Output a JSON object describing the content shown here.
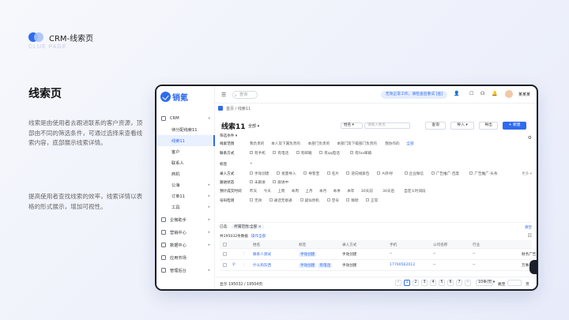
{
  "slide": {
    "title": "CRM-线索页",
    "subtitle": "CLUE PAGE",
    "section_title": "线索页",
    "para1": "线索是由使用者去跟进联系的客户资源，顶部由不同的筛选条件，可通过选择来查看线索内容，底部展示线索详情。",
    "para2": "提高使用者查找线索的效率，线索详情以表格的形式展示，增加可视性。"
  },
  "app": {
    "brand": "销氪",
    "topbar": {
      "search_placeholder": "查询",
      "notice": "无效正常工作，请检查后重试 [查]",
      "user": "某某某"
    },
    "sidebar": [
      {
        "label": "CRM",
        "type": "group",
        "chev": "▾"
      },
      {
        "label": "待分配线索11",
        "type": "sub"
      },
      {
        "label": "线索11",
        "type": "sub",
        "active": true
      },
      {
        "label": "客户",
        "type": "sub"
      },
      {
        "label": "联系人",
        "type": "sub"
      },
      {
        "label": "商机",
        "type": "sub"
      },
      {
        "label": "公海",
        "type": "sub",
        "chev": "▸"
      },
      {
        "label": "订单11",
        "type": "sub",
        "chev": "▸"
      },
      {
        "label": "工具",
        "type": "sub",
        "chev": "▸"
      },
      {
        "label": "企微助手",
        "type": "group",
        "chev": "▸"
      },
      {
        "label": "营销中心",
        "type": "group",
        "chev": "▸"
      },
      {
        "label": "数据中心",
        "type": "group",
        "chev": "▸"
      },
      {
        "label": "应用市场",
        "type": "group"
      },
      {
        "label": "管理后台",
        "type": "group",
        "chev": "▸"
      }
    ],
    "breadcrumb": "首页  /  线索11",
    "page_title": "线索11",
    "scope": "全部 ▾",
    "field_select": "姓名 ▾",
    "field_input_placeholder": "请输入姓名",
    "actions": {
      "query": "查询",
      "import": "导入 ▾",
      "export": "导出",
      "new": "+ 新建"
    },
    "filters": {
      "tag": "筛选条件 ▾",
      "rows": [
        {
          "label": "线索范围",
          "opts": [
            "我负责的",
            "本人及下属负责的",
            "本部门负责的",
            "本部门及下级部门负责的",
            "我协作的",
            "全部"
          ]
        },
        {
          "label": "联系方式",
          "opts": [
            "有手机",
            "有电话",
            "有邮箱",
            "有qq电话",
            "有fax邮箱"
          ]
        },
        {
          "label": "标签",
          "opts": [
            "+"
          ]
        },
        {
          "label": "录入方式",
          "opts": [
            "手动创建",
            "批量导入",
            "导客宝",
            "名片",
            "逆向线索包",
            "AI外呼",
            "企业微信",
            "广告推广-百度",
            "广告推广-头条"
          ]
        },
        {
          "label": "跟进状态",
          "opts": [
            "未跟进",
            "跟进中"
          ]
        },
        {
          "label": "预计成交时间",
          "opts": [
            "昨天",
            "今天",
            "上周",
            "本周",
            "上月",
            "本月",
            "本季",
            "本年",
            "30天前",
            "30天后",
            "自定义时间段"
          ]
        },
        {
          "label": "号码检测",
          "opts": [
            "无效",
            "通话无接通",
            "疑似停机",
            "空号",
            "静默",
            "正常"
          ]
        }
      ],
      "more": "更多 ▾"
    },
    "chips": {
      "label": "已选:",
      "items": [
        "所属范围:全部 ×"
      ],
      "clear": "清空"
    },
    "selection": {
      "text": "共195032条数据",
      "link": "操作全部"
    },
    "table": {
      "headers": [
        "",
        "",
        "",
        "姓名",
        "标签",
        "录入方式",
        "手机",
        "公司名称",
        "行业",
        ""
      ],
      "rows": [
        {
          "name": "联系人测试",
          "tags": [
            "手动创建"
          ],
          "entry": "手动创建",
          "phone": "--",
          "company": "--",
          "industry": "--",
          "extra": "财务广告"
        },
        {
          "name": "什么狗东西",
          "tags": [
            "手动创建",
            "有电话"
          ],
          "entry": "手动创建",
          "phone": "17700562012",
          "company": "--",
          "industry": "--",
          "extra": "万事"
        }
      ]
    },
    "pager": {
      "total": "显示 195032 / 19504页",
      "pages": [
        "‹",
        "1",
        "2",
        "3",
        "4",
        "5",
        "6",
        "7",
        "›"
      ],
      "size": "10条/页 ▾",
      "jump": "跳至",
      "go": "页"
    }
  }
}
